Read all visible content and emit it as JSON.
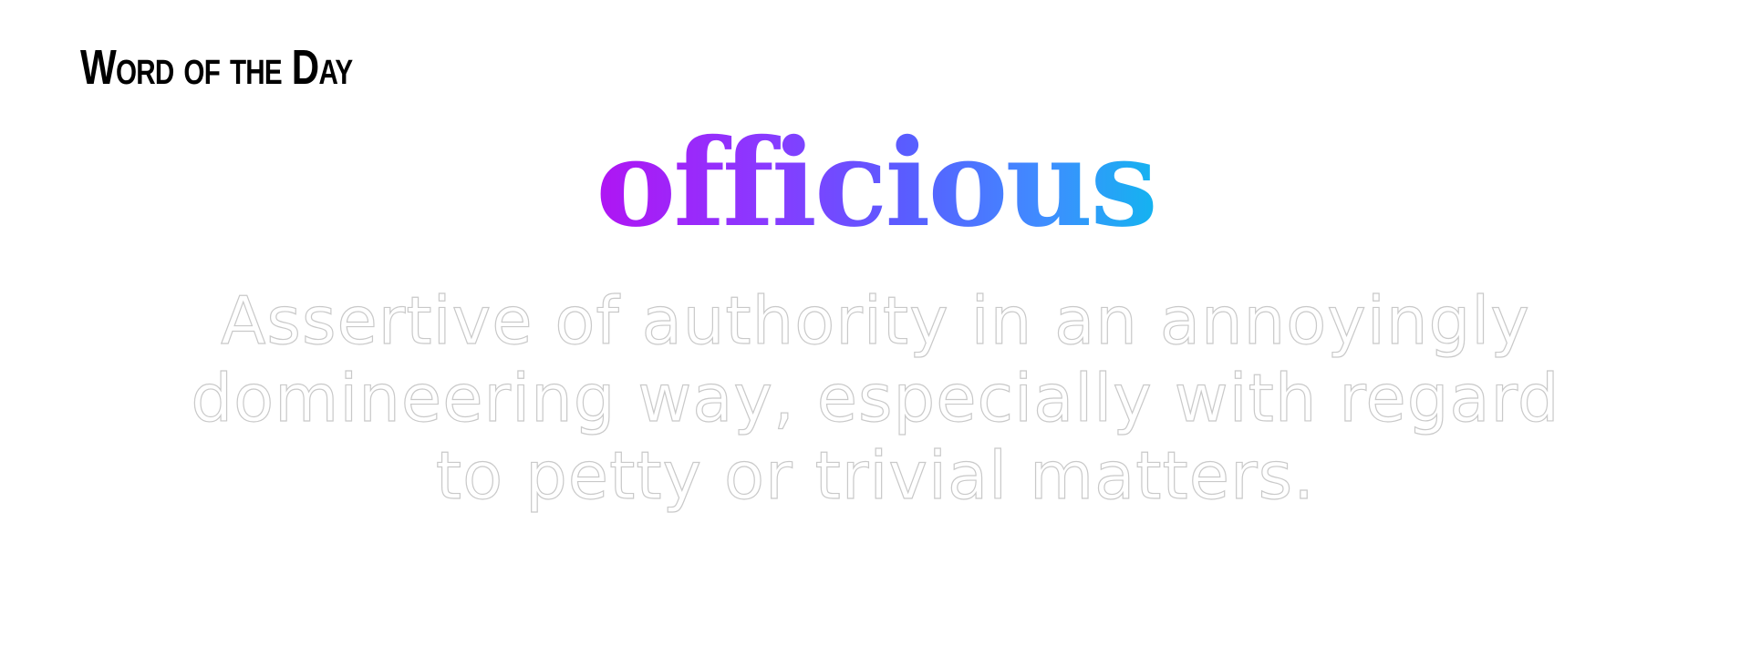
{
  "header": {
    "title": "Word of the Day"
  },
  "word": {
    "text": "officious",
    "gradient_colors": [
      "#b014f3",
      "#8a39ff",
      "#5a5cff",
      "#3f8dff",
      "#14b3f0"
    ]
  },
  "definition": {
    "text": "Assertive of authority in an annoyingly domineering way, especially with regard to petty or trivial matters."
  },
  "colors": {
    "background": "#ffffff",
    "header_text": "#000000",
    "definition_outline": "#c9c9c9"
  }
}
